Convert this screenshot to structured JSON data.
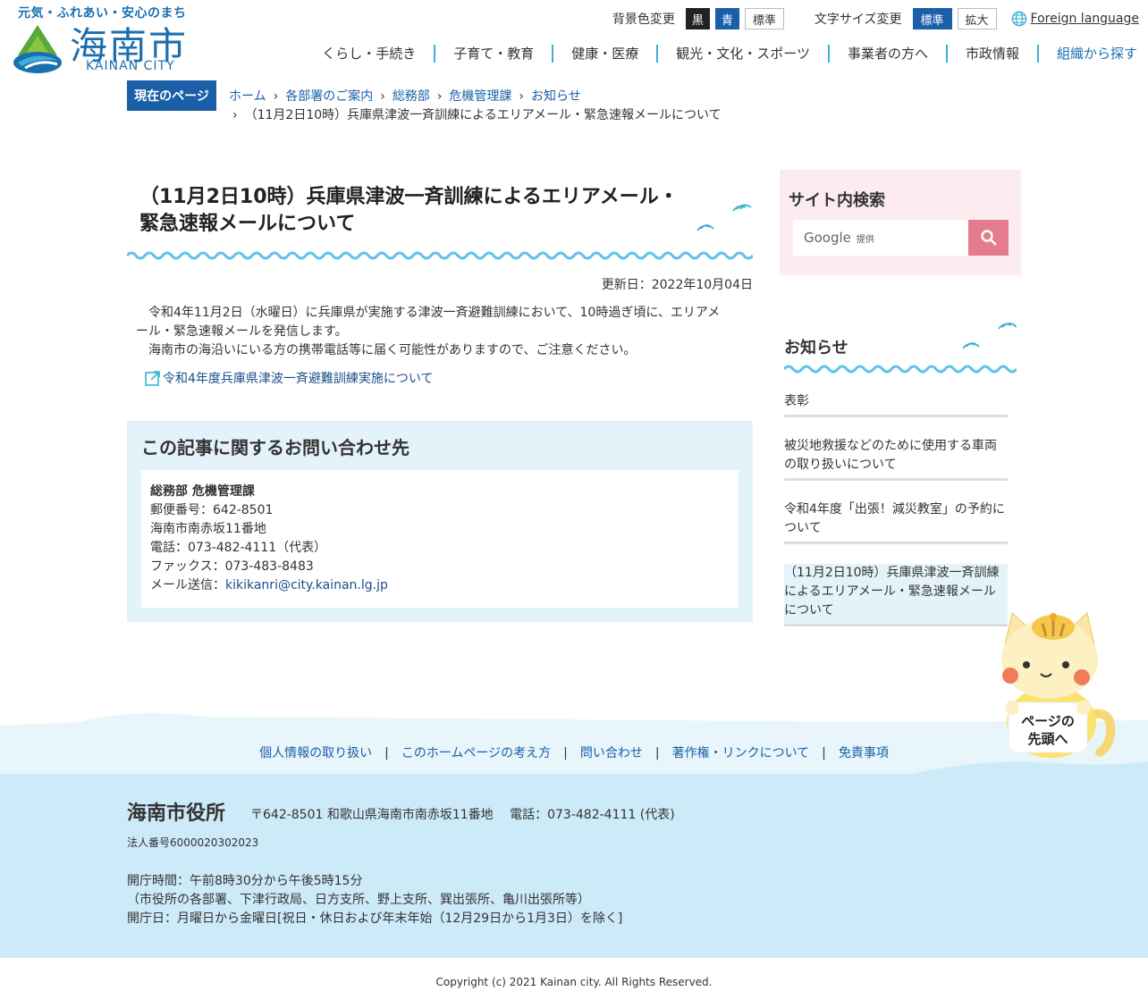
{
  "header": {
    "tagline": "元気・ふれあい・安心のまち",
    "logo_name": "海南市",
    "logo_en": "KAINAN CITY",
    "bg_label": "背景色変更",
    "bg_black": "黒",
    "bg_blue": "青",
    "bg_standard": "標準",
    "font_label": "文字サイズ変更",
    "font_standard": "標準",
    "font_large": "拡大",
    "foreign_language": "Foreign language"
  },
  "nav": {
    "items": [
      "くらし・手続き",
      "子育て・教育",
      "健康・医療",
      "観光・文化・スポーツ",
      "事業者の方へ",
      "市政情報",
      "組織から探す"
    ]
  },
  "breadcrumb": {
    "badge": "現在のページ",
    "items": [
      "ホーム",
      "各部署のご案内",
      "総務部",
      "危機管理課",
      "お知らせ"
    ],
    "current": "（11月2日10時）兵庫県津波一斉訓練によるエリアメール・緊急速報メールについて"
  },
  "article": {
    "title": "（11月2日10時）兵庫県津波一斉訓練によるエリアメール・緊急速報メールについて",
    "updated": "更新日：2022年10月04日",
    "paragraph1": "令和4年11月2日（水曜日）に兵庫県が実施する津波一斉避難訓練において、10時過ぎ頃に、エリアメール・緊急速報メールを発信します。",
    "paragraph2": "海南市の海沿いにいる方の携帯電話等に届く可能性がありますので、ご注意ください。",
    "link": "令和4年度兵庫県津波一斉避難訓練実施について"
  },
  "contact": {
    "heading": "この記事に関するお問い合わせ先",
    "dept": "総務部 危機管理課",
    "postal": "郵便番号：642-8501",
    "address": "海南市南赤坂11番地",
    "phone": "電話：073-482-4111（代表）",
    "fax": "ファックス：073-483-8483",
    "mail_label": "メール送信：",
    "mail": "kikikanri@city.kainan.lg.jp"
  },
  "sidebar": {
    "search_title": "サイト内検索",
    "search_google": "Google",
    "search_provided": "提供",
    "news_title": "お知らせ",
    "news": [
      "表彰",
      "被災地救援などのために使用する車両の取り扱いについて",
      "令和4年度「出張！減災教室」の予約について",
      "（11月2日10時）兵庫県津波一斉訓練によるエリアメール・緊急速報メールについて"
    ]
  },
  "pagetop": {
    "line1": "ページの",
    "line2": "先頭へ"
  },
  "footer": {
    "links": [
      "個人情報の取り扱い",
      "このホームページの考え方",
      "問い合わせ",
      "著作権・リンクについて",
      "免責事項"
    ],
    "name": "海南市役所",
    "address": "〒642-8501 和歌山県海南市南赤坂11番地　 電話：073-482-4111 (代表)",
    "corp_no": "法人番号6000020302023",
    "hours1": "開庁時間：午前8時30分から午後5時15分",
    "hours2": "（市役所の各部署、下津行政局、日方支所、野上支所、巽出張所、亀川出張所等）",
    "hours3": "開庁日：月曜日から金曜日[祝日・休日および年末年始（12月29日から1月3日）を除く]",
    "copyright": "Copyright (c) 2021 Kainan city. All Rights Reserved."
  },
  "colors": {
    "primary": "#1a5fa8",
    "accent_cyan": "#3bb0d8",
    "search_btn": "#e57c8d",
    "footer_bg": "#cdeaf8"
  }
}
